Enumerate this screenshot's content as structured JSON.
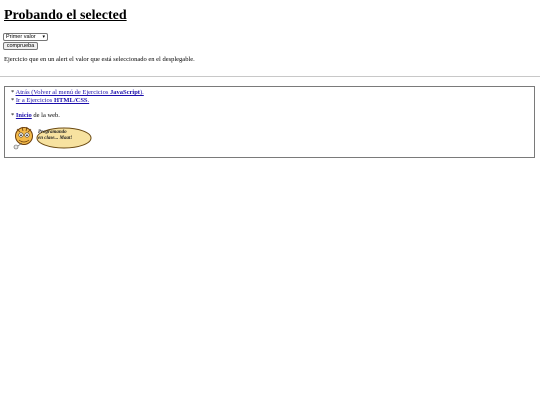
{
  "page": {
    "title": "Probando el selected",
    "select_value": "Primer valor",
    "button_label": "compruebа",
    "description": "Ejercicio que en un alert el valor que está seleccionado en el desplegable."
  },
  "nav": {
    "back_prefix": "* ",
    "back_link": "Atrás (Volver al menú de Ejercicios ",
    "back_link_bold": "JavaScript",
    "back_link_end": ").",
    "exercises_prefix": "* ",
    "exercises_link": " Ir a Ejercicios ",
    "exercises_link_bold": "HTML/CSS",
    "exercises_link_end": ".",
    "home_prefix": "* ",
    "home_link": "Inicio",
    "home_suffix": " de la web."
  },
  "logo": {
    "line1": "Programando",
    "line2": "en clase... Maat!"
  }
}
